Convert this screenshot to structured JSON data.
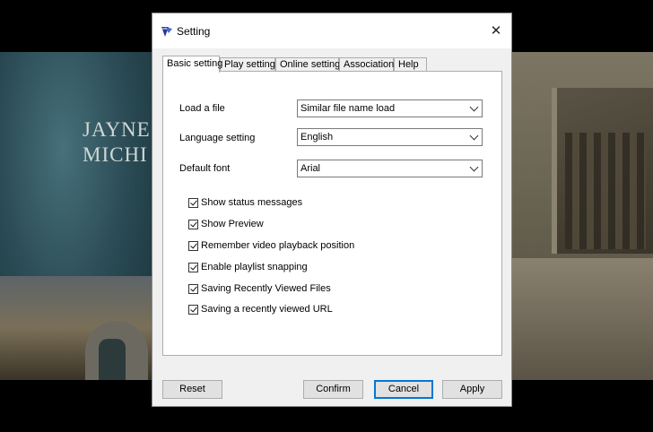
{
  "background": {
    "credit_lines": [
      "JAYNE",
      "MICHI"
    ]
  },
  "dialog": {
    "title": "Setting",
    "icon": "app-logo-icon",
    "close_glyph": "✕"
  },
  "tabs": [
    {
      "label": "Basic setting",
      "active": true
    },
    {
      "label": "Play setting",
      "active": false
    },
    {
      "label": "Online setting",
      "active": false
    },
    {
      "label": "Association",
      "active": false
    },
    {
      "label": "Help",
      "active": false
    }
  ],
  "fields": {
    "load_file": {
      "label": "Load a file",
      "value": "Similar file name load"
    },
    "language": {
      "label": "Language setting",
      "value": "English"
    },
    "font": {
      "label": "Default font",
      "value": "Arial"
    }
  },
  "checkboxes": [
    {
      "label": "Show status messages",
      "checked": true
    },
    {
      "label": "Show Preview",
      "checked": true
    },
    {
      "label": "Remember video playback position",
      "checked": true
    },
    {
      "label": "Enable playlist snapping",
      "checked": true
    },
    {
      "label": "Saving Recently Viewed Files",
      "checked": true
    },
    {
      "label": "Saving a recently viewed URL",
      "checked": true
    }
  ],
  "buttons": {
    "reset": "Reset",
    "confirm": "Confirm",
    "cancel": "Cancel",
    "apply": "Apply"
  },
  "colors": {
    "focus": "#0078d7",
    "dialog_bg": "#f0f0f0"
  }
}
